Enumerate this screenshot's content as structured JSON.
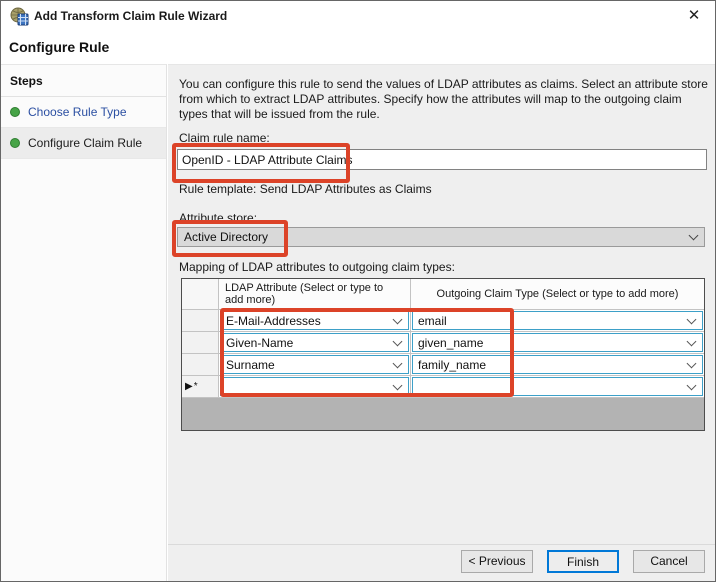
{
  "window": {
    "title": "Add Transform Claim Rule Wizard",
    "close_icon": "✕"
  },
  "page": {
    "title": "Configure Rule"
  },
  "sidebar": {
    "title": "Steps",
    "items": [
      {
        "label": "Choose Rule Type"
      },
      {
        "label": "Configure Claim Rule"
      }
    ]
  },
  "main": {
    "description": "You can configure this rule to send the values of LDAP attributes as claims. Select an attribute store from which to extract LDAP attributes. Specify how the attributes will map to the outgoing claim types that will be issued from the rule.",
    "claim_rule_name_label": "Claim rule name:",
    "claim_rule_name_value": "OpenID - LDAP Attribute Claims",
    "rule_template": "Rule template: Send LDAP Attributes as Claims",
    "attribute_store_label": "Attribute store:",
    "attribute_store_value": "Active Directory",
    "mapping_label": "Mapping of LDAP attributes to outgoing claim types:",
    "table": {
      "columns": [
        "LDAP Attribute (Select or type to add more)",
        "Outgoing Claim Type (Select or type to add more)"
      ],
      "rows": [
        {
          "ldap": "E-Mail-Addresses",
          "claim": "email"
        },
        {
          "ldap": "Given-Name",
          "claim": "given_name"
        },
        {
          "ldap": "Surname",
          "claim": "family_name"
        }
      ],
      "new_row_marker": "▶*"
    }
  },
  "footer": {
    "previous_label": "< Previous",
    "finish_label": "Finish",
    "cancel_label": "Cancel"
  },
  "colors": {
    "annotation_red": "#dc4328",
    "default_button_blue": "#0078d7",
    "combo_border_blue": "#3da0c8",
    "step_link_blue": "#2b4fa2",
    "step_bullet_green": "#47a447"
  }
}
